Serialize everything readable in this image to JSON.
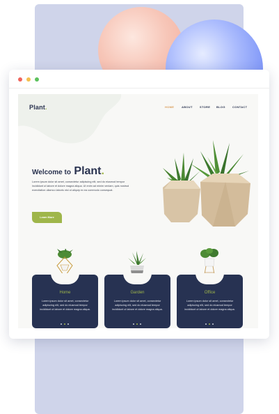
{
  "colors": {
    "panel": "#cfd4ea",
    "navy": "#273252",
    "accent_green": "#9fb64a",
    "accent_orange": "#d99a55"
  },
  "site": {
    "logo": "Plant",
    "logo_dot": ".",
    "nav": [
      "HOME",
      "ABOUT",
      "STORE",
      "BLOG",
      "CONTACT"
    ],
    "active_nav": "HOME",
    "hero": {
      "title_prefix": "Welcome to",
      "title_brand": "Plant",
      "title_dot": ".",
      "text": "Lorem ipsum dolor sit amet, consectetur adipiscing elit, sed do eiusmod tempor incididunt ut labore et dolore magna aliqua. Ut enim ad minim veniam, quis nostrud exercitation ullamco laboris nisi ut aliquip ex ea commodo consequat.",
      "button": "Learn More"
    },
    "cards": [
      {
        "title": "Home",
        "text": "Lorem ipsum dolor sit amet, consectetur adipiscing elit, sed do eiusmod tempor incididunt ut labore et dolore magna aliqua.",
        "icon": "plant-brass-stand-icon"
      },
      {
        "title": "Garden",
        "text": "Lorem ipsum dolor sit amet, consectetur adipiscing elit, sed do eiusmod tempor incididunt ut labore et dolore magna aliqua.",
        "icon": "plant-grey-pot-icon"
      },
      {
        "title": "Office",
        "text": "Lorem ipsum dolor sit amet, consectetur adipiscing elit, sed do eiusmod tempor incididunt ut labore et dolore magna aliqua.",
        "icon": "plant-white-stand-icon"
      }
    ]
  }
}
